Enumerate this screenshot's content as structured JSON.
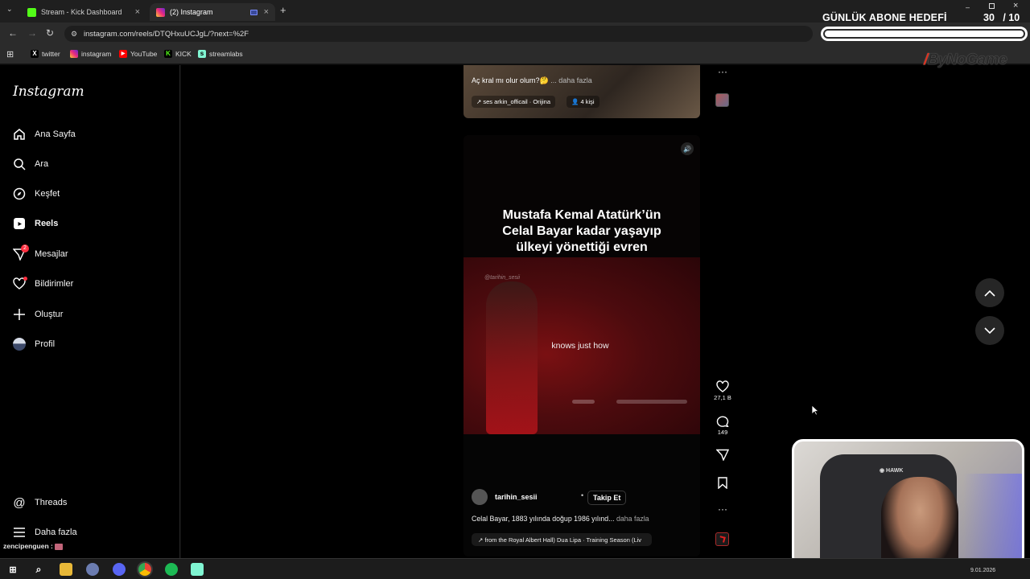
{
  "browser": {
    "tabs": [
      {
        "label": "Stream - Kick Dashboard",
        "icon": "kick-icon",
        "color": "#53fc18"
      },
      {
        "label": "(2) Instagram",
        "icon": "instagram-icon",
        "color": "#e1306c"
      }
    ],
    "url": "instagram.com/reels/DTQHxuUCJgL/?next=%2F",
    "bookmarks": [
      {
        "label": "twitter",
        "icon": "x-icon"
      },
      {
        "label": "instagram",
        "icon": "instagram-icon"
      },
      {
        "label": "YouTube",
        "icon": "youtube-icon"
      },
      {
        "label": "KICK",
        "icon": "kick-icon"
      },
      {
        "label": "streamlabs",
        "icon": "streamlabs-icon"
      }
    ]
  },
  "overlay": {
    "goal_title": "GÜNLÜK ABONE HEDEFİ",
    "goal_current": 30,
    "goal_total": 10,
    "goal_count_text": "30   / 10",
    "goal_progress": 1.0,
    "brand": "ByNoGame",
    "chat_user": "zencipenguen :"
  },
  "sidebar": {
    "logo": "Instagram",
    "items": [
      {
        "label": "Ana Sayfa",
        "icon": "home-icon"
      },
      {
        "label": "Ara",
        "icon": "search-icon"
      },
      {
        "label": "Keşfet",
        "icon": "compass-icon"
      },
      {
        "label": "Reels",
        "icon": "reels-icon",
        "active": true
      },
      {
        "label": "Mesajlar",
        "icon": "messenger-icon",
        "badge": "2"
      },
      {
        "label": "Bildirimler",
        "icon": "heart-icon"
      },
      {
        "label": "Oluştur",
        "icon": "plus-icon"
      },
      {
        "label": "Profil",
        "icon": "avatar-icon"
      }
    ],
    "bottom": [
      {
        "label": "Threads",
        "icon": "threads-icon"
      },
      {
        "label": "Daha fazla",
        "icon": "menu-icon"
      }
    ]
  },
  "prev_reel": {
    "caption": "Aç kral mı olur olum?🤔",
    "more": "... daha fazla",
    "audio": "ses  arkin_officail · Orijina",
    "people": "4 kişi"
  },
  "reel": {
    "headline": [
      "Mustafa Kemal Atatürk’ün",
      "Celal Bayar kadar yaşayıp",
      "ülkeyi yönettiği evren"
    ],
    "watermark": "@tarihin_sesii",
    "subtitle": "knows just how",
    "username": "tarihin_sesii",
    "follow": "Takip Et",
    "caption": "Celal Bayar, 1883 yılında doğup 1986 yılınd...",
    "more": "daha fazla",
    "audio": "from the Royal Albert Hall)  Dua Lipa · Training Season (Liv"
  },
  "actions": {
    "likes": "27,1 B",
    "comments": "149"
  },
  "taskbar": {
    "date": "9.01.2026"
  }
}
